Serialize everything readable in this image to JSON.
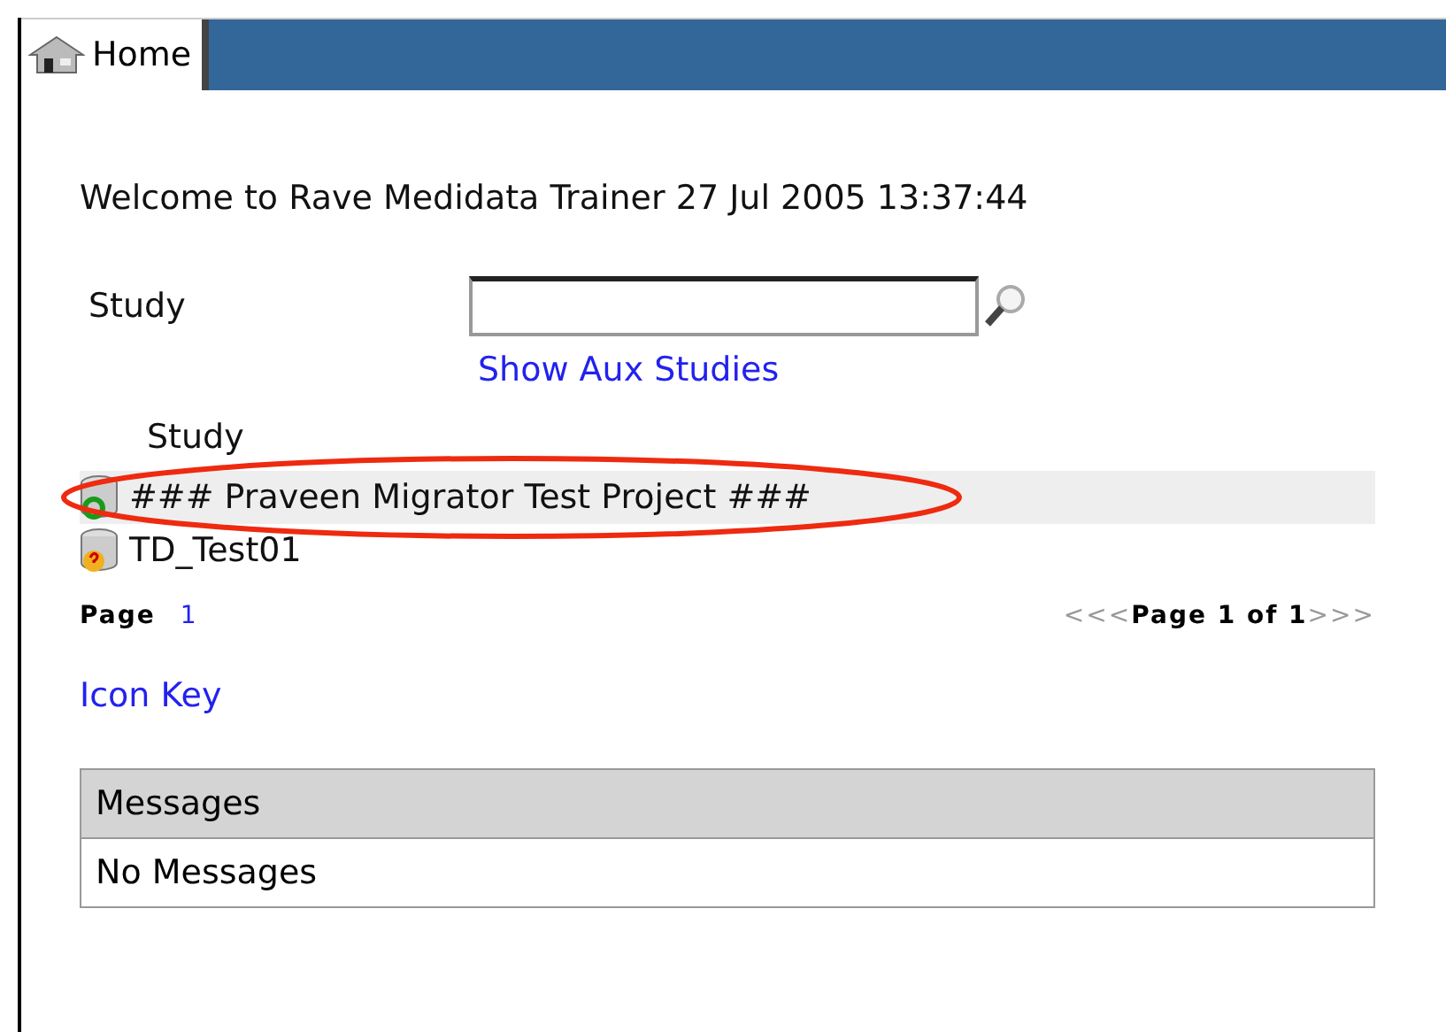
{
  "tabs": [
    {
      "label": "Home",
      "selected": true
    }
  ],
  "welcome": "Welcome to Rave Medidata Trainer 27 Jul 2005 13:37:44",
  "search": {
    "label": "Study",
    "link": "Show Aux Studies"
  },
  "studies": {
    "heading": "Study",
    "rows": [
      {
        "name": "### Praveen Migrator Test Project ###",
        "kind": "active",
        "highlighted": true
      },
      {
        "name": "TD_Test01",
        "kind": "unknown",
        "highlighted": false
      }
    ]
  },
  "pager": {
    "label": "Page",
    "pages": [
      "1"
    ],
    "first": "<<<",
    "summary": "Page 1 of 1",
    "last": ">>>"
  },
  "icon_key": "Icon Key",
  "messages": {
    "title": "Messages",
    "text": "No Messages"
  }
}
